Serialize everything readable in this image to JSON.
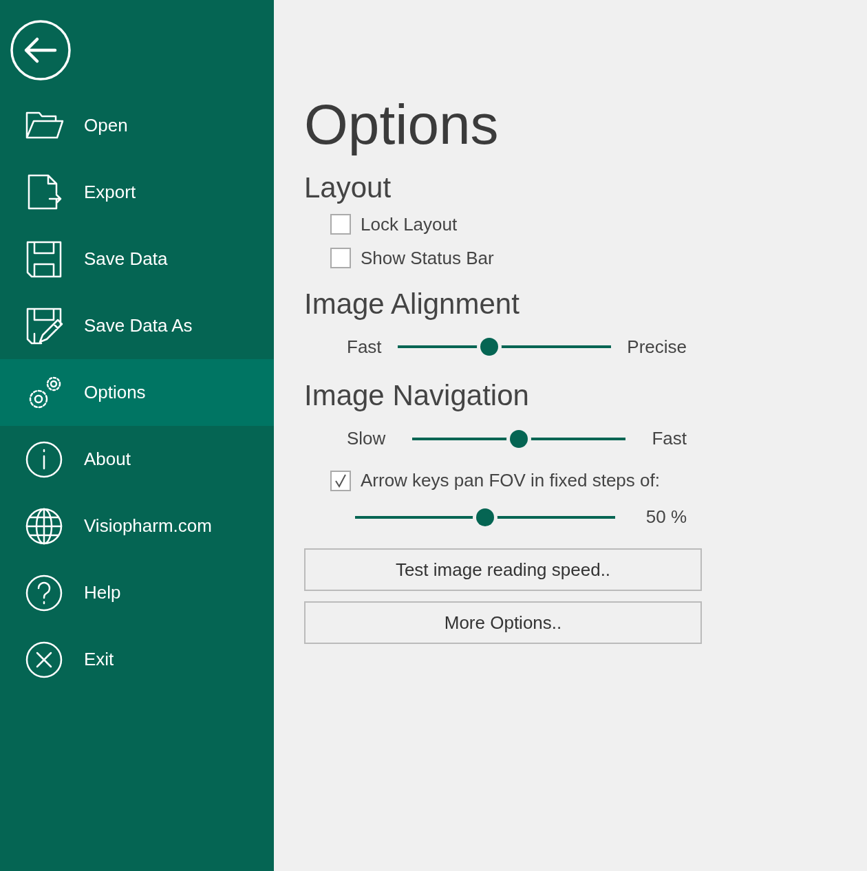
{
  "sidebar": {
    "items": [
      {
        "kind": "open",
        "label": "Open",
        "selected": false
      },
      {
        "kind": "export",
        "label": "Export",
        "selected": false
      },
      {
        "kind": "save",
        "label": "Save Data",
        "selected": false
      },
      {
        "kind": "save_as",
        "label": "Save Data As",
        "selected": false
      },
      {
        "kind": "options",
        "label": "Options",
        "selected": true
      },
      {
        "kind": "about",
        "label": "About",
        "selected": false
      },
      {
        "kind": "web",
        "label": "Visiopharm.com",
        "selected": false
      },
      {
        "kind": "help",
        "label": "Help",
        "selected": false
      },
      {
        "kind": "exit",
        "label": "Exit",
        "selected": false
      }
    ]
  },
  "page_title": "Options",
  "sections": [
    {
      "heading": "Layout",
      "controls": [
        {
          "kind": "checkbox",
          "label": "Lock Layout",
          "checked": false
        },
        {
          "kind": "checkbox",
          "label": "Show Status Bar",
          "checked": false
        }
      ]
    },
    {
      "heading": "Image Alignment",
      "controls": [
        {
          "kind": "slider",
          "min_label": "Fast",
          "max_label": "Precise",
          "level": 0.43
        }
      ]
    },
    {
      "heading": "Image Navigation",
      "controls": [
        {
          "kind": "slider",
          "min_label": "Slow",
          "max_label": "Fast",
          "level": 0.5
        },
        {
          "kind": "checkbox",
          "label": "Arrow keys pan FOV in fixed steps of:",
          "checked": true
        },
        {
          "kind": "value_slider",
          "reading": "50 %",
          "level": 0.5
        }
      ]
    }
  ],
  "buttons": [
    "Test image reading speed..",
    "More Options.."
  ]
}
